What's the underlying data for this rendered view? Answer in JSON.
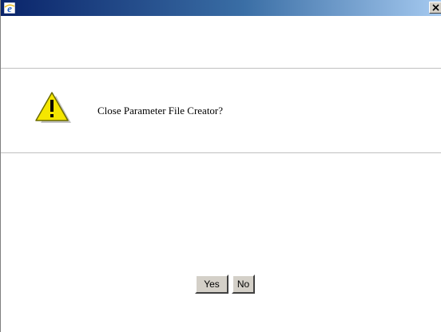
{
  "titlebar": {
    "icon": "ie-icon",
    "close_icon": "close-icon"
  },
  "dialog": {
    "icon": "warning-icon",
    "message": "Close Parameter File Creator?"
  },
  "buttons": {
    "yes_label": "Yes",
    "no_label": "No"
  },
  "colors": {
    "titlebar_start": "#0a246a",
    "titlebar_end": "#a6caf0",
    "button_face": "#d4d0c8",
    "warning_yellow": "#f5e600"
  }
}
